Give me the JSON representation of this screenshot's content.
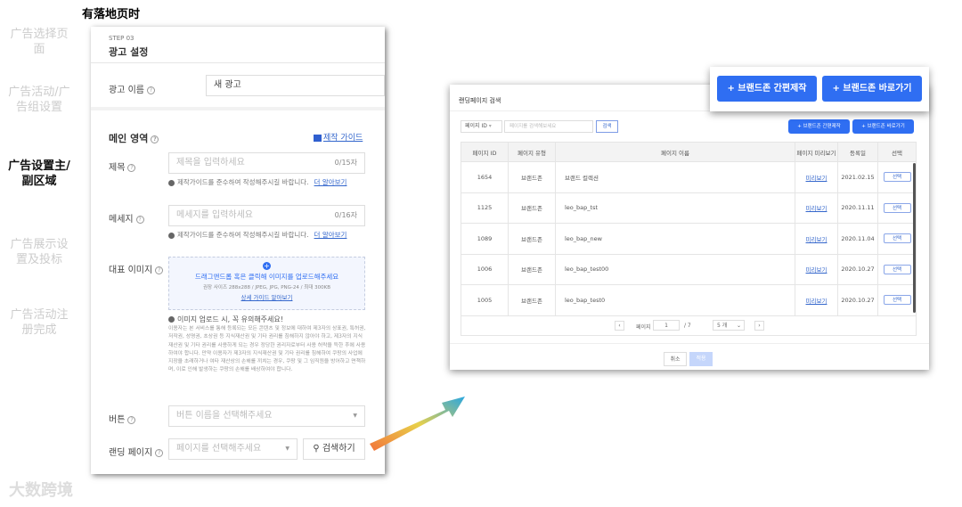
{
  "caption": "有落地页时",
  "nav": [
    "广告选择页面",
    "广告活动/广告组设置",
    "广告设置主/副区域",
    "广告展示设置及投标",
    "广告活动注册完成"
  ],
  "watermark": "大数跨境",
  "form": {
    "step": "STEP 03",
    "title": "광고 설정",
    "ad_name_label": "광고 이름",
    "ad_name_value": "새 광고",
    "main_area": "메인 영역",
    "guide_link": "제작 가이드",
    "title_label": "제목",
    "title_placeholder": "제목을 입력하세요",
    "title_count": "0/15자",
    "hint": "제작가이드를 준수하여 작성해주시길 바랍니다.",
    "more": "더 알아보기",
    "msg_label": "메세지",
    "msg_placeholder": "메세지를 입력하세요",
    "msg_count": "0/16자",
    "image_label": "대표 이미지",
    "upload_text": "드래그앤드롭 혹은 클릭해 이미지를 업로드해주세요",
    "upload_spec": "권장 사이즈 288x288 / JPEG, JPG, PNG-24 / 최대 300KB",
    "upload_guide": "상세 가이드 알아보기",
    "notice_title": "이미지 업로드 시, 꼭 유의해주세요!",
    "notice_body": "이용자는 본 서비스를 통해 등록되는 모든 콘텐츠 및 정보에 대하여 제3자의 상표권, 특허권, 저작권, 성명권, 초상권 등 지식재산권 및 기타 권리를 침해하지 않아야 하고, 제3자의 지식재산권 및 기타 권리를 사용하게 되는 경우 정당한 권리자로부터 사용 허락을 득한 후에 사용하여야 합니다. 만약 이용자가 제3자의 지식재산권 및 기타 권리를 침해하여 쿠팡의 사업에 지장을 초래하거나 여타 재산상의 손해를 끼치는 경우, 쿠팡 및 그 임직원을 방어하고 면책하며, 이로 인해 발생하는 쿠팡의 손해를 배상하여야 합니다.",
    "button_label": "버튼",
    "button_placeholder": "버튼 이름을 선택해주세요",
    "landing_label": "랜딩 페이지",
    "landing_placeholder": "페이지를 선택해주세요",
    "search_btn": "검색하기"
  },
  "callout": {
    "create": "브랜드존 간편제작",
    "goto": "브랜드존 바로가기"
  },
  "modal": {
    "title": "랜딩페이지 검색",
    "filter": "페이지 ID",
    "search_placeholder": "페이지를 검색해보세요",
    "search_btn": "검색",
    "create": "브랜드존 간편제작",
    "goto": "브랜드존 바로가기",
    "headers": [
      "페이지 ID",
      "페이지 유형",
      "페이지 이름",
      "페이지 미리보기",
      "등록일",
      "선택"
    ],
    "rows": [
      [
        "1654",
        "브랜드존",
        "브랜드 컬렉션",
        "미리보기",
        "2021.02.15",
        "선택"
      ],
      [
        "1125",
        "브랜드존",
        "leo_bap_tst",
        "미리보기",
        "2020.11.11",
        "선택"
      ],
      [
        "1089",
        "브랜드존",
        "leo_bap_new",
        "미리보기",
        "2020.11.04",
        "선택"
      ],
      [
        "1006",
        "브랜드존",
        "leo_bap_test00",
        "미리보기",
        "2020.10.27",
        "선택"
      ],
      [
        "1005",
        "브랜드존",
        "leo_bap_test0",
        "미리보기",
        "2020.10.27",
        "선택"
      ]
    ],
    "page_label": "페이지",
    "page": "1",
    "total": "/ 7",
    "per_page": "5 개",
    "cancel": "취소",
    "apply": "적용"
  }
}
